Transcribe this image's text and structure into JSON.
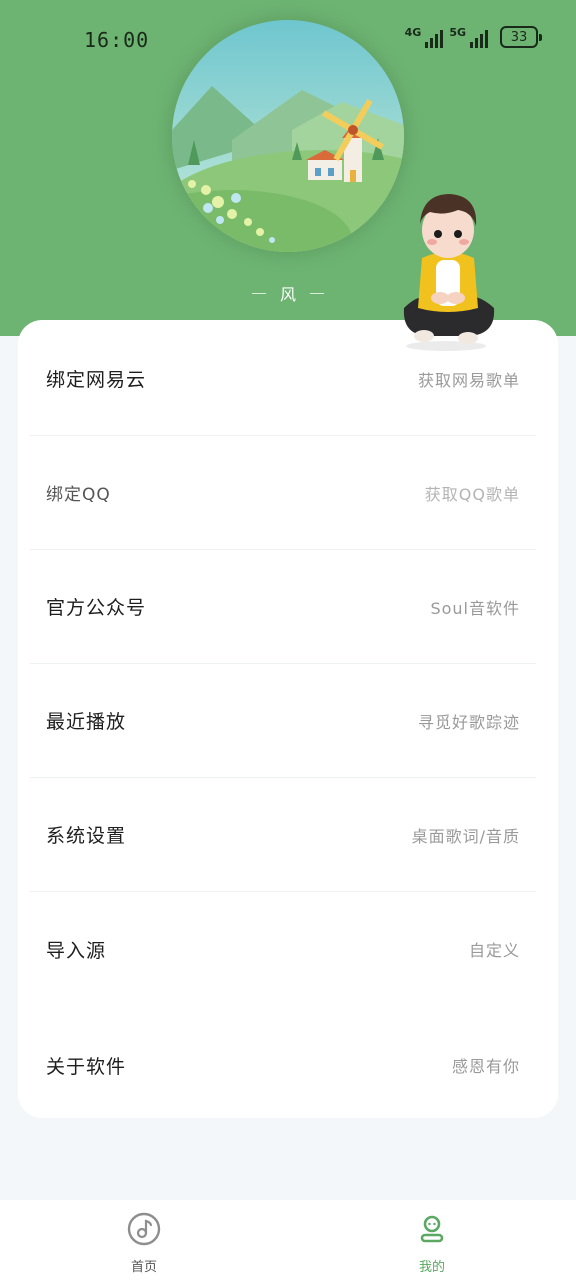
{
  "status": {
    "time": "16:00",
    "network1": "4G",
    "network2": "5G",
    "battery": "33"
  },
  "profile": {
    "name": "风"
  },
  "menu": [
    {
      "label": "绑定网易云",
      "value": "获取网易歌单"
    },
    {
      "label": "绑定QQ",
      "value": "获取QQ歌单"
    },
    {
      "label": "官方公众号",
      "value": "Soul音软件"
    },
    {
      "label": "最近播放",
      "value": "寻觅好歌踪迹"
    },
    {
      "label": "系统设置",
      "value": "桌面歌词/音质"
    },
    {
      "label": "导入源",
      "value": "自定义"
    },
    {
      "label": "关于软件",
      "value": "感恩有你"
    }
  ],
  "nav": {
    "home_label": "首页",
    "home_icon": "music-disc-icon",
    "mine_label": "我的",
    "mine_icon": "user-icon"
  },
  "colors": {
    "header_green": "#6db372",
    "accent_green": "#5aa862",
    "page_bg": "#f4f7fa"
  }
}
